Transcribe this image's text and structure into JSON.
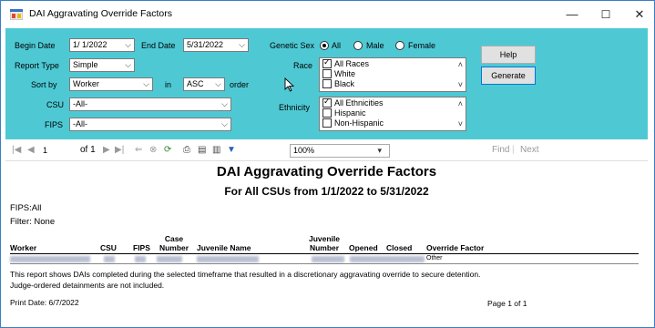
{
  "window": {
    "title": "DAI Aggravating Override Factors",
    "minimize": "—",
    "maximize": "☐",
    "close": "✕"
  },
  "params": {
    "begin_date_label": "Begin Date",
    "begin_date_value": "1/ 1/2022",
    "end_date_label": "End Date",
    "end_date_value": "5/31/2022",
    "report_type_label": "Report Type",
    "report_type_value": "Simple",
    "sort_by_label": "Sort by",
    "sort_by_value": "Worker",
    "in_label": "in",
    "order_value": "ASC",
    "order_label": "order",
    "csu_label": "CSU",
    "csu_value": "-All-",
    "fips_label": "FIPS",
    "fips_value": "-All-",
    "genetic_sex_label": "Genetic Sex",
    "sex_options": [
      "All",
      "Male",
      "Female"
    ],
    "race_label": "Race",
    "race_items": [
      "All Races",
      "White",
      "Black"
    ],
    "ethnicity_label": "Ethnicity",
    "ethnicity_items": [
      "All Ethnicities",
      "Hispanic",
      "Non-Hispanic"
    ],
    "help_label": "Help",
    "generate_label": "Generate"
  },
  "toolbar": {
    "page_value": "1",
    "of_label": "of 1",
    "zoom_value": "100%",
    "find_label": "Find",
    "sep": "|",
    "next_label": "Next"
  },
  "report": {
    "title": "DAI Aggravating Override Factors",
    "subtitle": "For All CSUs  from  1/1/2022  to  5/31/2022",
    "fips_line": "FIPS:All",
    "filter_line": "Filter: None",
    "columns": [
      "Worker",
      "CSU",
      "FIPS",
      "Case\nNumber",
      "Juvenile Name",
      "Juvenile\nNumber",
      "Opened",
      "Closed",
      "Override Factor"
    ],
    "row_override": "Other",
    "footnote_1": "This report shows DAIs completed during the selected timeframe that resulted in a discretionary aggravating override to secure detention.",
    "footnote_2": "Judge-ordered detainments are not included.",
    "print_date": "Print Date: 6/7/2022",
    "page_label": "Page 1 of 1"
  }
}
